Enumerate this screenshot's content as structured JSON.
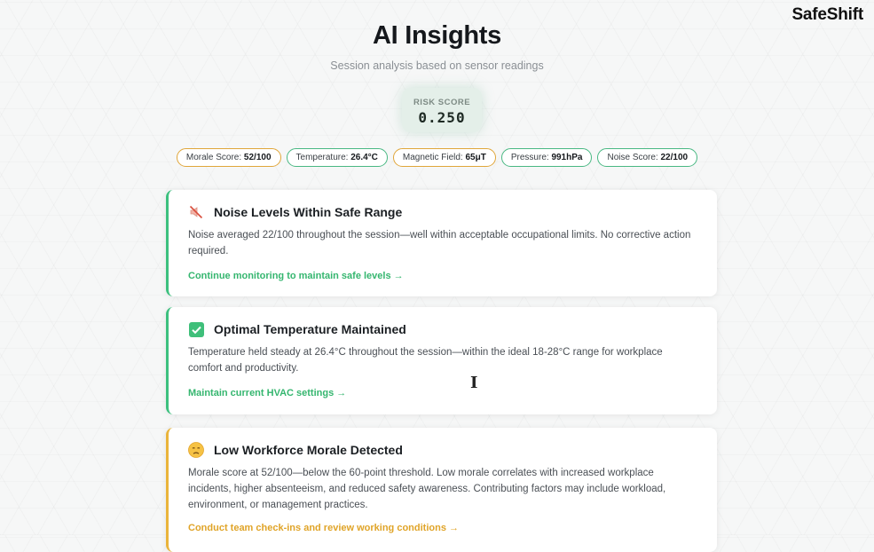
{
  "brand": "SafeShift",
  "header": {
    "title": "AI Insights",
    "subtitle": "Session analysis based on sensor readings"
  },
  "risk": {
    "label": "RISK SCORE",
    "value": "0.250"
  },
  "metrics": [
    {
      "label": "Morale Score:",
      "value": "52/100",
      "status": "warning",
      "color": "#e0a63a"
    },
    {
      "label": "Temperature:",
      "value": "26.4°C",
      "status": "ok",
      "color": "#49b883"
    },
    {
      "label": "Magnetic Field:",
      "value": "65μT",
      "status": "warning",
      "color": "#e0a63a"
    },
    {
      "label": "Pressure:",
      "value": "991hPa",
      "status": "ok",
      "color": "#49b883"
    },
    {
      "label": "Noise Score:",
      "value": "22/100",
      "status": "ok",
      "color": "#49b883"
    }
  ],
  "insights": [
    {
      "icon": "muted-speaker-icon",
      "title": "Noise Levels Within Safe Range",
      "body": "Noise averaged 22/100 throughout the session—well within acceptable occupational limits. No corrective action required.",
      "action": "Continue monitoring to maintain safe levels →",
      "status": "ok"
    },
    {
      "icon": "check-box-icon",
      "title": "Optimal Temperature Maintained",
      "body": "Temperature held steady at 26.4°C throughout the session—within the ideal 18-28°C range for workplace comfort and productivity.",
      "action": "Maintain current HVAC settings →",
      "status": "ok"
    },
    {
      "icon": "sad-face-icon",
      "title": "Low Workforce Morale Detected",
      "body": "Morale score at 52/100—below the 60-point threshold. Low morale correlates with increased workplace incidents, higher absenteeism, and reduced safety awareness. Contributing factors may include workload, environment, or management practices.",
      "action": "Conduct team check-ins and review working conditions →",
      "status": "warning"
    }
  ],
  "colors": {
    "ok": "#3cc07e",
    "warning": "#eab43a"
  }
}
